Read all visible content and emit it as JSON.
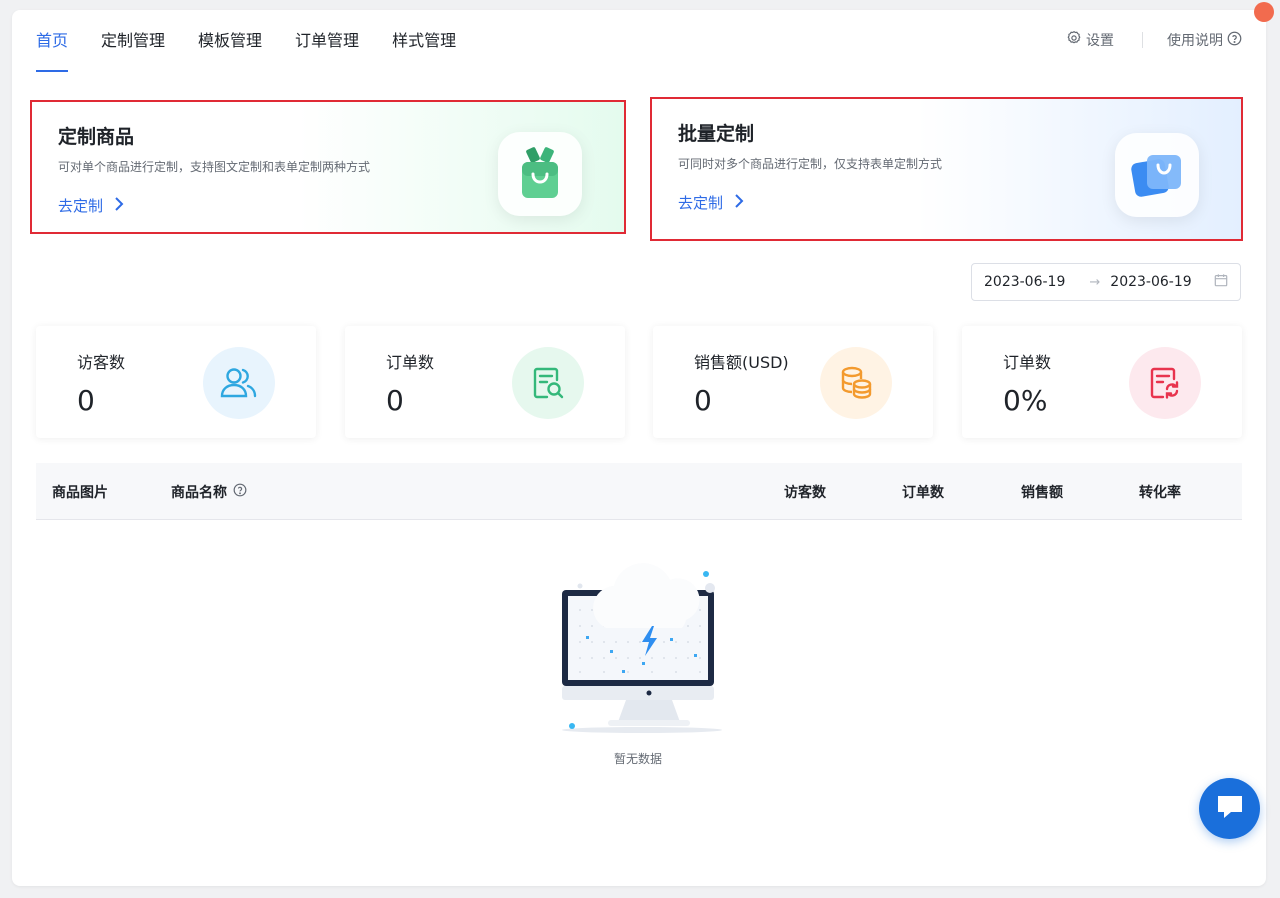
{
  "nav": {
    "tabs": [
      {
        "label": "首页",
        "active": true
      },
      {
        "label": "定制管理"
      },
      {
        "label": "模板管理"
      },
      {
        "label": "订单管理"
      },
      {
        "label": "样式管理"
      }
    ],
    "settings_label": "设置",
    "help_label": "使用说明"
  },
  "promos": [
    {
      "title": "定制商品",
      "desc": "可对单个商品进行定制，支持图文定制和表单定制两种方式",
      "cta": "去定制",
      "icon": "shopping-bag-icon"
    },
    {
      "title": "批量定制",
      "desc": "可同时对多个商品进行定制，仅支持表单定制方式",
      "cta": "去定制",
      "icon": "stacked-bags-icon"
    }
  ],
  "date_range": {
    "start": "2023-06-19",
    "separator": "→",
    "end": "2023-06-19"
  },
  "stats": [
    {
      "label": "访客数",
      "value": "0",
      "icon": "users-icon",
      "color": "#2ea7e0",
      "bg": "#e8f4fd"
    },
    {
      "label": "订单数",
      "value": "0",
      "icon": "order-search-icon",
      "color": "#34b87a",
      "bg": "#e6f8ee"
    },
    {
      "label": "销售额(USD)",
      "value": "0",
      "icon": "coins-icon",
      "color": "#f39a2e",
      "bg": "#fff3e4"
    },
    {
      "label": "订单数",
      "value": "0%",
      "icon": "order-refresh-icon",
      "color": "#e8344e",
      "bg": "#fde9ee"
    }
  ],
  "table": {
    "columns": [
      "商品图片",
      "商品名称",
      "访客数",
      "订单数",
      "销售额",
      "转化率"
    ],
    "empty_text": "暂无数据"
  },
  "colors": {
    "accent": "#2e6be6",
    "highlight_border": "#e02a35",
    "chat_button": "#1a6fdb"
  }
}
